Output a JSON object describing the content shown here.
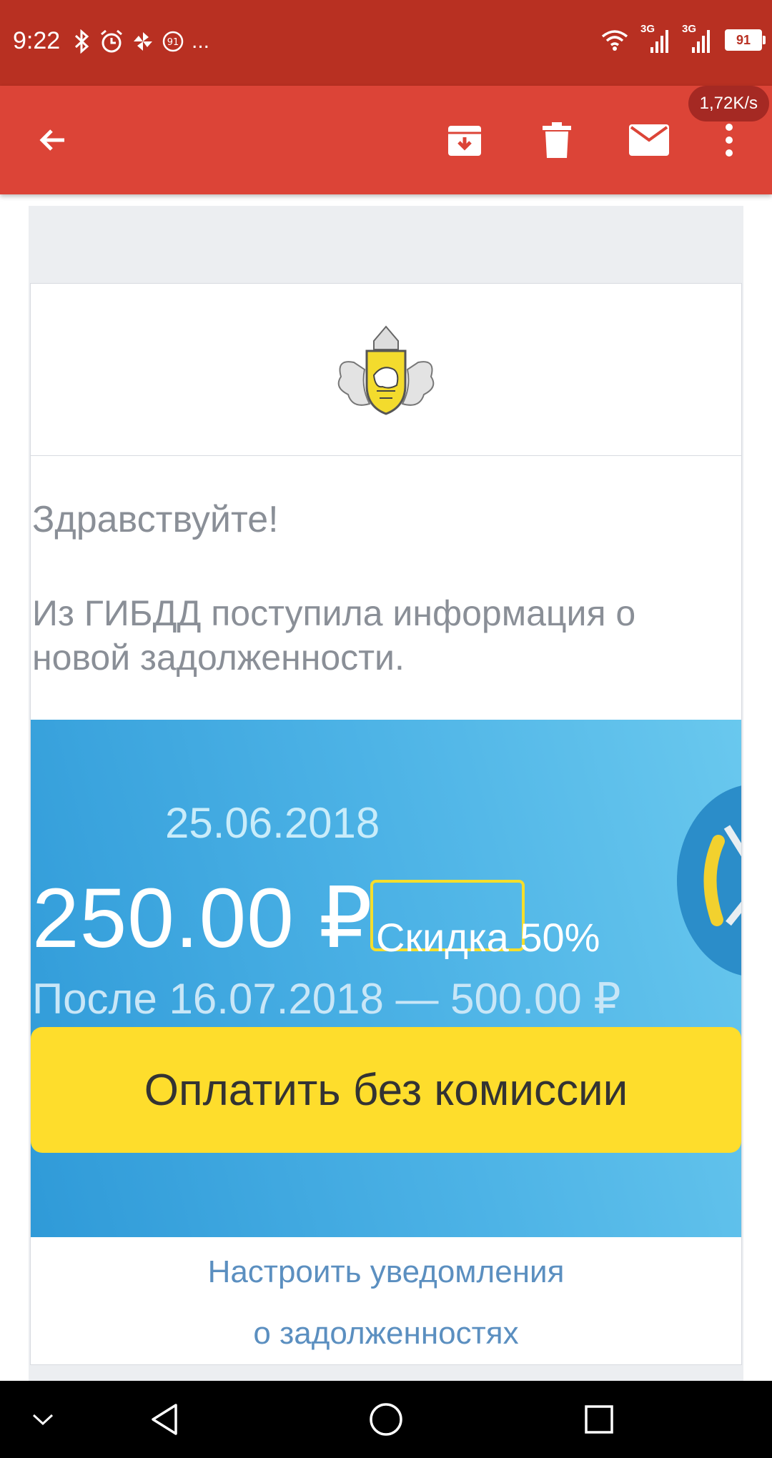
{
  "status_bar": {
    "time": "9:22",
    "more": "...",
    "network_1": "3G",
    "network_2": "3G",
    "battery": "91"
  },
  "app_bar": {
    "speed_badge": "1,72K/s",
    "icons": [
      "back-arrow-icon",
      "archive-icon",
      "trash-icon",
      "mail-icon",
      "more-vert-icon"
    ]
  },
  "email": {
    "greeting": "Здравствуйте!",
    "info": "Из ГИБДД поступила информация о новой задолженности.",
    "fine": {
      "date": "25.06.2018",
      "amount": "250.00 ₽",
      "discount": "Скидка 50%",
      "after": "После 16.07.2018 — 500.00 ₽",
      "pay_button": "Оплатить без комиссии"
    },
    "notifications_line1": "Настроить уведомления",
    "notifications_line2": "о задолженностях"
  },
  "colors": {
    "status_bar": "#b83022",
    "app_bar": "#dc4437",
    "banner_blue": "#3ca6de",
    "pay_button": "#fedd2c",
    "link": "#5b8fc0"
  }
}
